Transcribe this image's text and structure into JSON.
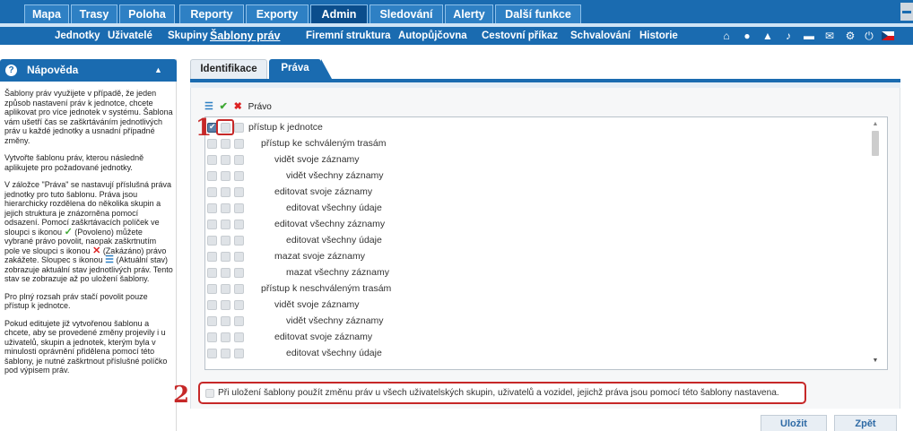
{
  "main_nav": [
    {
      "label": "Mapa"
    },
    {
      "label": "Trasy"
    },
    {
      "label": "Poloha"
    },
    {
      "label": "Reporty"
    },
    {
      "label": "Exporty"
    },
    {
      "label": "Admin",
      "active": true
    },
    {
      "label": "Sledování"
    },
    {
      "label": "Alerty"
    },
    {
      "label": "Další funkce"
    }
  ],
  "sub_nav": [
    {
      "label": "Jednotky"
    },
    {
      "label": "Uživatelé"
    },
    {
      "label": "Skupiny"
    },
    {
      "label": "Šablony práv",
      "active": true
    },
    {
      "label": "Firemní struktura"
    },
    {
      "label": "Autopůjčovna"
    },
    {
      "label": "Cestovní příkaz"
    },
    {
      "label": "Schvalování"
    },
    {
      "label": "Historie"
    }
  ],
  "toolbar_icons": [
    "home-icon",
    "chat-icon",
    "alert-icon",
    "sound-icon",
    "folder-icon",
    "mail-icon",
    "settings-icon",
    "power-icon",
    "flag-icon"
  ],
  "help": {
    "title": "Nápověda",
    "p1": "Šablony práv využijete v případě, že jeden způsob nastavení práv k jednotce, chcete aplikovat pro více jednotek v systému. Šablona vám ušetří čas se zaškrtáváním jednotlivých práv u každé jednotky a usnadní případné změny.",
    "p2": "Vytvořte šablonu práv, kterou následně aplikujete pro požadované jednotky.",
    "p3a": "V záložce \"Práva\" se nastavují příslušná práva jednotky pro tuto šablonu. Práva jsou hierarchicky rozdělena do několika skupin a jejich struktura je znázorněna pomocí odsazení. Pomocí zaškrtávacích políček ve sloupci s ikonou",
    "p3b": "(Povoleno) můžete vybrané právo povolit, naopak zaškrtnutím pole ve sloupci s ikonou",
    "p3c": "(Zakázáno) právo zakážete. Sloupec s ikonou",
    "p3d": "(Aktuální stav) zobrazuje aktuální stav jednotlivých práv. Tento stav se zobrazuje až po uložení šablony.",
    "p4": "Pro plný rozsah práv stačí povolit pouze přístup k jednotce.",
    "p5": "Pokud editujete již vytvořenou šablonu a chcete, aby se provedené změny projevily i u uživatelů, skupin a jednotek, kterým byla v minulosti oprávnění přidělena pomocí této šablony, je nutné zaškrtnout příslušné políčko pod výpisem práv."
  },
  "content_tabs": [
    {
      "label": "Identifikace"
    },
    {
      "label": "Práva",
      "active": true
    }
  ],
  "rights_header": {
    "label": "Právo"
  },
  "rights": [
    {
      "label": "přístup k jednotce",
      "level": 0,
      "checked": true
    },
    {
      "label": "přístup ke schváleným trasám",
      "level": 1
    },
    {
      "label": "vidět svoje záznamy",
      "level": 2
    },
    {
      "label": "vidět všechny záznamy",
      "level": 3
    },
    {
      "label": "editovat svoje záznamy",
      "level": 2
    },
    {
      "label": "editovat všechny údaje",
      "level": 3
    },
    {
      "label": "editovat všechny záznamy",
      "level": 2
    },
    {
      "label": "editovat všechny údaje",
      "level": 3
    },
    {
      "label": "mazat svoje záznamy",
      "level": 2
    },
    {
      "label": "mazat všechny záznamy",
      "level": 3
    },
    {
      "label": "přístup k neschváleným trasám",
      "level": 1
    },
    {
      "label": "vidět svoje záznamy",
      "level": 2
    },
    {
      "label": "vidět všechny záznamy",
      "level": 3
    },
    {
      "label": "editovat svoje záznamy",
      "level": 2
    },
    {
      "label": "editovat všechny údaje",
      "level": 3
    }
  ],
  "apply_option": {
    "label": "Při uložení šablony použít změnu práv u všech uživatelských skupin, uživatelů a vozidel, jejichž práva jsou pomocí této šablony nastavena."
  },
  "markers": {
    "one": "1",
    "two": "2"
  },
  "buttons": {
    "save": "Uložit",
    "back": "Zpět"
  },
  "colors": {
    "nav_blue": "#1a6bb0",
    "allowed": "#3fa834",
    "denied": "#dd2222",
    "annotation": "#c62828"
  }
}
